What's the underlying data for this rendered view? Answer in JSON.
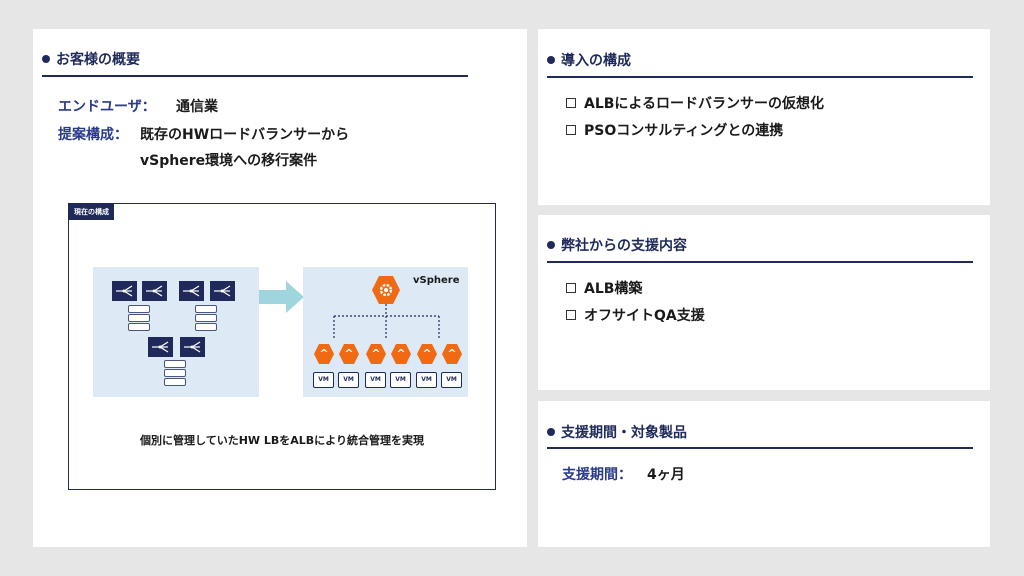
{
  "overview": {
    "title": "お客様の概要",
    "end_user_label": "エンドユーザ：",
    "end_user_value": "通信業",
    "proposal_label": "提案構成：",
    "proposal_line1": "既存のHWロードバランサーから",
    "proposal_line2": "vSphere環境への移行案件",
    "figure": {
      "tab_label": "現在の構成",
      "target_label": "vSphere",
      "vm_label": "VM",
      "caption": "個別に管理していたHW LBをALBにより統合管理を実現"
    }
  },
  "deployment": {
    "title": "導入の構成",
    "items": [
      "ALBによるロードバランサーの仮想化",
      "PSOコンサルティングとの連携"
    ]
  },
  "support": {
    "title": "弊社からの支援内容",
    "items": [
      "ALB構築",
      "オフサイトQA支援"
    ]
  },
  "period": {
    "title": "支援期間・対象製品",
    "label": "支援期間：",
    "value": "4ヶ月"
  },
  "colors": {
    "navy": "#1f2a5a",
    "orange": "#ef6a12",
    "light_blue": "#dde9f4",
    "arrow": "#9fd6de"
  }
}
